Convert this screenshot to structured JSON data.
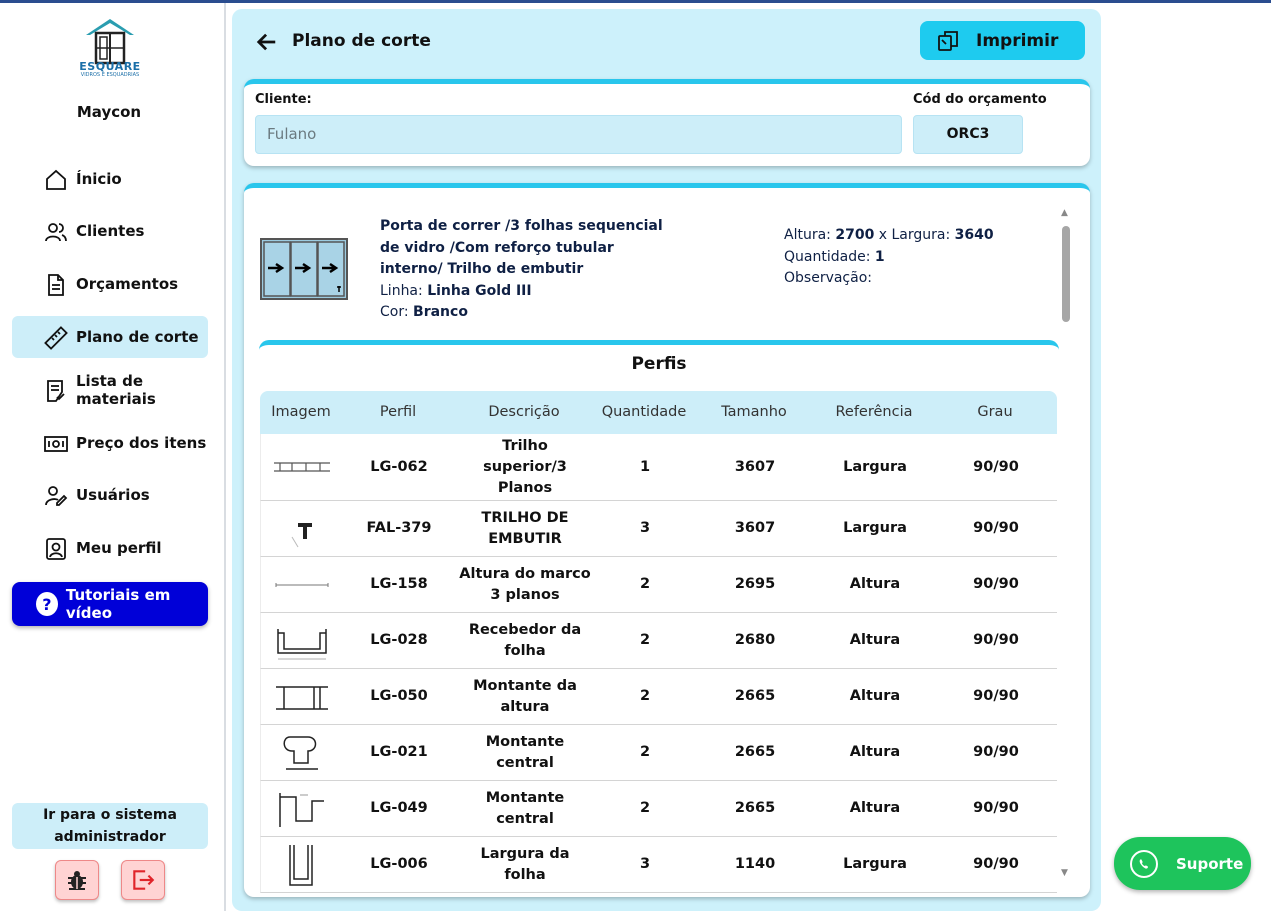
{
  "brand": {
    "name": "ESQUARE",
    "tagline": "VIDROS E ESQUADRIAS"
  },
  "user": {
    "name": "Maycon"
  },
  "nav": [
    {
      "label": "Ínicio",
      "icon": "home-icon",
      "active": false
    },
    {
      "label": "Clientes",
      "icon": "users-icon",
      "active": false
    },
    {
      "label": "Orçamentos",
      "icon": "document-icon",
      "active": false
    },
    {
      "label": "Plano de corte",
      "icon": "ruler-icon",
      "active": true
    },
    {
      "label": "Lista de materiais",
      "icon": "checklist-icon",
      "active": false
    },
    {
      "label": "Preço dos itens",
      "icon": "money-icon",
      "active": false
    },
    {
      "label": "Usuários",
      "icon": "user-edit-icon",
      "active": false
    },
    {
      "label": "Meu perfil",
      "icon": "profile-icon",
      "active": false
    }
  ],
  "tutorial": {
    "label": "Tutoriais em vídeo"
  },
  "admin_link": {
    "line1": "Ir para o sistema",
    "line2": "administrador"
  },
  "page": {
    "title": "Plano de corte",
    "print_label": "Imprimir"
  },
  "client": {
    "label": "Cliente:",
    "value": "Fulano"
  },
  "budget": {
    "label": "Cód do orçamento",
    "value": "ORC3"
  },
  "product": {
    "title_lines": [
      "Porta de correr /3 folhas sequencial",
      "de vidro /Com reforço tubular",
      "interno/ Trilho de embutir"
    ],
    "line_label": "Linha: ",
    "line_value": "Linha Gold III",
    "color_label": "Cor: ",
    "color_value": "Branco",
    "height_label": "Altura: ",
    "height_value": "2700",
    "width_label": " x Largura: ",
    "width_value": "3640",
    "qty_label": "Quantidade: ",
    "qty_value": "1",
    "obs_label": "Observação:"
  },
  "perfis": {
    "title": "Perfis",
    "headers": [
      "Imagem",
      "Perfil",
      "Descrição",
      "Quantidade",
      "Tamanho",
      "Referência",
      "Grau"
    ],
    "rows": [
      {
        "image": "profile-lg-062-icon",
        "perfil": "LG-062",
        "descricao": [
          "Trilho",
          "superior/3",
          "Planos"
        ],
        "quantidade": "1",
        "tamanho": "3607",
        "referencia": "Largura",
        "grau": "90/90"
      },
      {
        "image": "profile-fal-379-icon",
        "perfil": "FAL-379",
        "descricao": [
          "TRILHO DE",
          "EMBUTIR"
        ],
        "quantidade": "3",
        "tamanho": "3607",
        "referencia": "Largura",
        "grau": "90/90"
      },
      {
        "image": "profile-lg-158-icon",
        "perfil": "LG-158",
        "descricao": [
          "Altura do marco",
          "3 planos"
        ],
        "quantidade": "2",
        "tamanho": "2695",
        "referencia": "Altura",
        "grau": "90/90"
      },
      {
        "image": "profile-lg-028-icon",
        "perfil": "LG-028",
        "descricao": [
          "Recebedor da",
          "folha"
        ],
        "quantidade": "2",
        "tamanho": "2680",
        "referencia": "Altura",
        "grau": "90/90"
      },
      {
        "image": "profile-lg-050-icon",
        "perfil": "LG-050",
        "descricao": [
          "Montante da",
          "altura"
        ],
        "quantidade": "2",
        "tamanho": "2665",
        "referencia": "Altura",
        "grau": "90/90"
      },
      {
        "image": "profile-lg-021-icon",
        "perfil": "LG-021",
        "descricao": [
          "Montante",
          "central"
        ],
        "quantidade": "2",
        "tamanho": "2665",
        "referencia": "Altura",
        "grau": "90/90"
      },
      {
        "image": "profile-lg-049-icon",
        "perfil": "LG-049",
        "descricao": [
          "Montante",
          "central"
        ],
        "quantidade": "2",
        "tamanho": "2665",
        "referencia": "Altura",
        "grau": "90/90"
      },
      {
        "image": "profile-lg-006-icon",
        "perfil": "LG-006",
        "descricao": [
          "Largura da",
          "folha"
        ],
        "quantidade": "3",
        "tamanho": "1140",
        "referencia": "Largura",
        "grau": "90/90"
      }
    ]
  },
  "support": {
    "label": "Suporte"
  },
  "colors": {
    "accent": "#29c6ec",
    "panel": "#cdf1fb",
    "tutorial": "#0000d8",
    "support": "#1ec45c"
  }
}
